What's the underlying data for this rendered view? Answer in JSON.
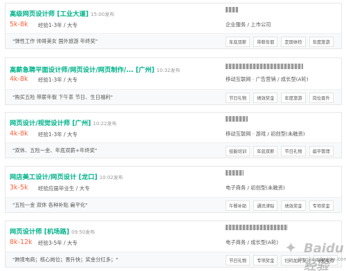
{
  "jobs": [
    {
      "title": "高级网页设计师 [工业大道]",
      "time": "15:00发布",
      "salary": "5k-8k",
      "requirements": "经验1-3年 / 大专",
      "industry": "企业服务 / 上市公司",
      "welfare": "\"弹性工作 帅哥美女 国外旅游 年终奖\"",
      "tags": [
        "年底双薪",
        "带薪年假",
        "定期体检",
        "年度旅游"
      ]
    },
    {
      "title": "高薪急聘平面设计师/网页设计/网页制作/...   [广州]",
      "time": "10:32发布",
      "salary": "4k-8k",
      "requirements": "经验1-3年 / 大专",
      "industry": "移动互联网 · 广告营销 / 成长型(A轮)",
      "welfare": "\"购买五险 带薪年假 下午茶 节日、生日福利\"",
      "tags": [
        "节日礼物",
        "绩效奖金",
        "年度旅游",
        "岗位晋升"
      ]
    },
    {
      "title": "网页设计/视觉设计师 [广州]",
      "time": "10:22发布",
      "salary": "4k-8k",
      "requirements": "经验1-3年 / 大专",
      "industry": "移动互联网 · 游戏 / 初创型(未融资)",
      "welfare": "\"双休、五险一金、年底双薪+年终奖\"",
      "tags": [
        "技能培训",
        "年底双薪",
        "节日礼物",
        "扁平管理"
      ]
    },
    {
      "title": "网店美工设计/网页设计 [龙口]",
      "time": "10:02发布",
      "salary": "3k-5k",
      "requirements": "经验应届毕业生 / 大专",
      "industry": "电子商务 / 初创型(未融资)",
      "welfare": "\"五险一金 双休 各种补贴 扁平化\"",
      "tags": [
        "午餐补助",
        "通讯津贴",
        "绩效奖金",
        "专项奖金"
      ]
    },
    {
      "title": "网页设计师 [机场路]",
      "time": "09:50发布",
      "salary": "8k-12k",
      "requirements": "经验3-5年 / 大专",
      "industry": "电子商务 / 成长型(A轮)",
      "welfare": "\"跨境电商；核心岗位；晋升快；奖金分红多；\"",
      "tags": [
        "节日礼物",
        "专项奖金",
        "扫码加好友",
        "带薪年假"
      ]
    }
  ],
  "watermark": {
    "main": "Baidu经验",
    "sub": "jingyan.baidu.com"
  }
}
